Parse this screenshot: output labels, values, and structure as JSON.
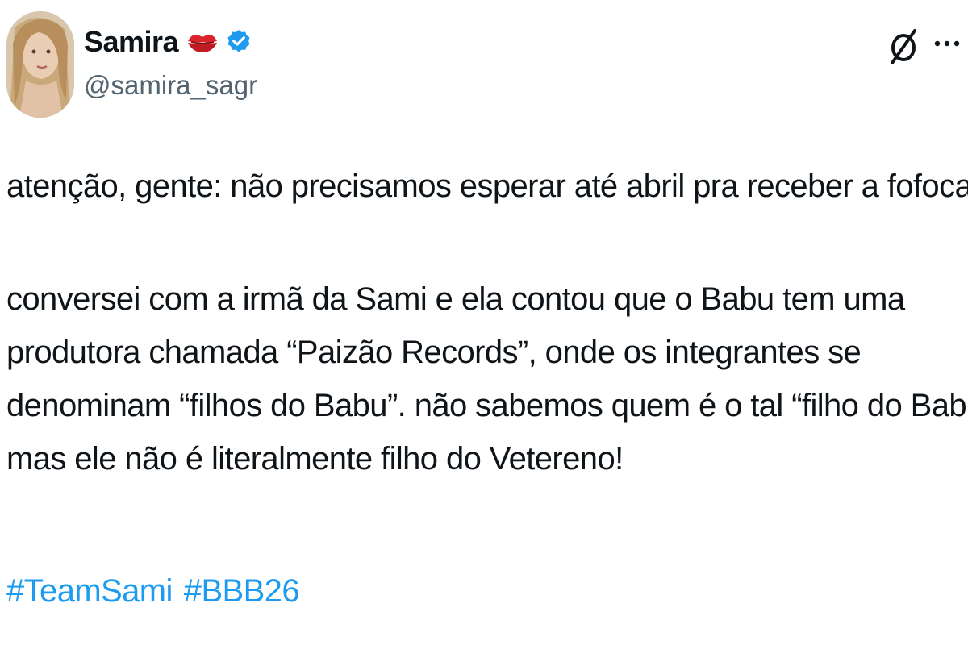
{
  "author": {
    "display_name": "Samira",
    "handle": "@samira_sagr",
    "verified": true
  },
  "icons": {
    "avatar": "avatar-photo",
    "kiss": "kiss-mark-icon",
    "verified": "verified-badge-icon",
    "grok": "grok-icon",
    "more": "more-options-icon",
    "speaking_head": "speaking-head-icon"
  },
  "colors": {
    "text": "#0f1419",
    "secondary_text": "#536471",
    "link": "#1d9bf0",
    "verified": "#1d9bf0",
    "kiss": "#d9242c"
  },
  "tweet": {
    "paragraph1": "atenção, gente: não precisamos esperar até abril pra receber a fofoca",
    "paragraph2_lines": [
      "conversei com a irmã da Sami e ela contou que o Babu tem uma",
      "produtora chamada “Paizão Records”, onde os integrantes se",
      "denominam “filhos do Babu”. não sabemos quem é o tal “filho do Babu”,",
      "mas ele não é literalmente filho do Vetereno!"
    ],
    "hashtags": [
      "#TeamSami",
      "#BBB26"
    ]
  }
}
